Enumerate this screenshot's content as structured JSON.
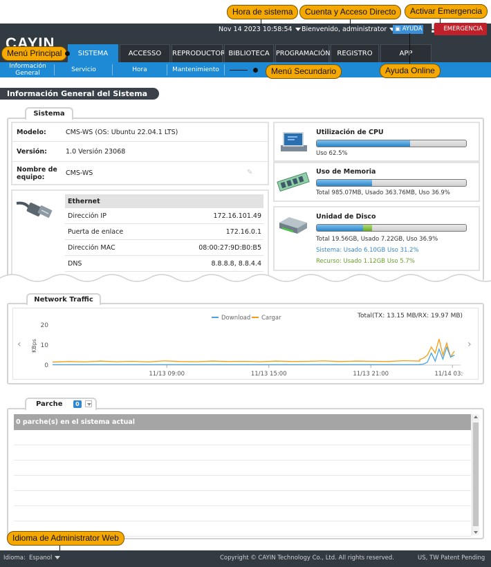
{
  "header": {
    "logo": "CAYIN",
    "system_time": "Nov 14 2023 10:58:54",
    "welcome": "Bienvenido, administrator",
    "help_label": "AYUDA",
    "emergency_label": "EMERGENCIA",
    "emergency_mark": "!"
  },
  "main_nav": {
    "tabs": [
      {
        "label": "SISTEMA"
      },
      {
        "label": "ACCESSO"
      },
      {
        "label": "REPRODUCTOR"
      },
      {
        "label": "BIBLIOTECA"
      },
      {
        "label": "PROGRAMACIÓN"
      },
      {
        "label": "REGISTRO"
      },
      {
        "label": "APP"
      }
    ]
  },
  "sub_nav": {
    "items": [
      {
        "label": "Información\nGeneral"
      },
      {
        "label": "Servicio"
      },
      {
        "label": "Hora"
      },
      {
        "label": "Mantenimiento"
      }
    ]
  },
  "callouts": {
    "system_time": "Hora de sistema",
    "account": "Cuenta y Acceso Directo",
    "emergency": "Activar Emergencia",
    "main_menu": "Menú Principal",
    "sub_menu": "Menú Secundario",
    "help": "Ayuda Online",
    "language": "Idioma de Administrator Web"
  },
  "page_title": "Información General del Sistema",
  "system_panel": {
    "tab_label": "Sistema",
    "model_label": "Modelo:",
    "model_value": "CMS-WS (OS: Ubuntu 22.04.1 LTS)",
    "version_label": "Versión:",
    "version_value": "1.0 Versión 23068",
    "name_label": "Nombre de equipo:",
    "name_value": "CMS-WS",
    "ethernet": {
      "title": "Ethernet",
      "rows": [
        {
          "label": "Dirección IP",
          "value": "172.16.101.49"
        },
        {
          "label": "Puerta de enlace",
          "value": "172.16.0.1"
        },
        {
          "label": "Dirección MAC",
          "value": "08:00:27:9D:B0:B5"
        },
        {
          "label": "DNS",
          "value": "8.8.8.8, 8.8.4.4"
        }
      ]
    },
    "cpu": {
      "title": "Utilización de CPU",
      "text": "Uso 62.5%",
      "percent": 62.5
    },
    "memory": {
      "title": "Uso de Memoria",
      "text": "Total 985.07MB, Usado 363.76MB, Uso 36.9%",
      "percent": 36.9
    },
    "disk": {
      "title": "Unidad de Disco",
      "text": "Total 19.56GB, Usado 7.22GB, Uso 36.9%",
      "system_text": "Sistema: Usado 6.10GB Uso 31.2%",
      "resource_text": "Recurso: Usado 1.12GB Uso 5.7%",
      "system_percent": 31.2,
      "resource_percent": 5.7
    }
  },
  "traffic_panel": {
    "tab_label": "Network Traffic",
    "total": "Total(TX: 13.15 MB/RX: 19.97 MB)"
  },
  "chart_data": {
    "type": "line",
    "ylabel": "KBps",
    "ylim": [
      0,
      20
    ],
    "yticks": [
      "20",
      "10",
      "0"
    ],
    "xticks": [
      "11/13 09:00",
      "11/13 15:00",
      "11/13 21:00",
      "11/14 03:00"
    ],
    "series": [
      {
        "name": "Download",
        "color": "#4aa3df",
        "values": [
          0.2,
          0.2,
          0.2,
          0.2,
          0.2,
          0.2,
          0.2,
          0.2,
          0.2,
          0.2,
          0.2,
          0.2,
          0.2,
          0.2,
          0.2,
          0.2,
          0.2,
          0.2,
          0.2,
          0.2,
          0.2,
          0.2,
          0.2,
          0.2,
          0.3,
          0.5,
          1.5,
          6,
          2,
          8,
          3,
          9,
          4,
          5
        ]
      },
      {
        "name": "Cargar",
        "color": "#f39c12",
        "values": [
          1.5,
          1.8,
          1.6,
          2.0,
          1.7,
          1.9,
          1.6,
          2.1,
          1.8,
          1.7,
          2.0,
          1.8,
          1.9,
          1.7,
          2.0,
          1.8,
          1.9,
          2.1,
          1.8,
          2.0,
          1.9,
          1.8,
          2.2,
          2.0,
          2.8,
          3.5,
          5,
          9,
          6,
          13,
          5,
          11,
          4,
          7
        ]
      }
    ]
  },
  "patch_panel": {
    "tab_label": "Parche",
    "count": "0",
    "header": "0 parche(s) en el sistema actual"
  },
  "footer": {
    "language_label": "Idioma:",
    "language_value": "Espanol",
    "copyright": "Copyright © CAYIN Technology Co., Ltd. All rights reserved.",
    "patent": "US, TW Patent Pending"
  }
}
